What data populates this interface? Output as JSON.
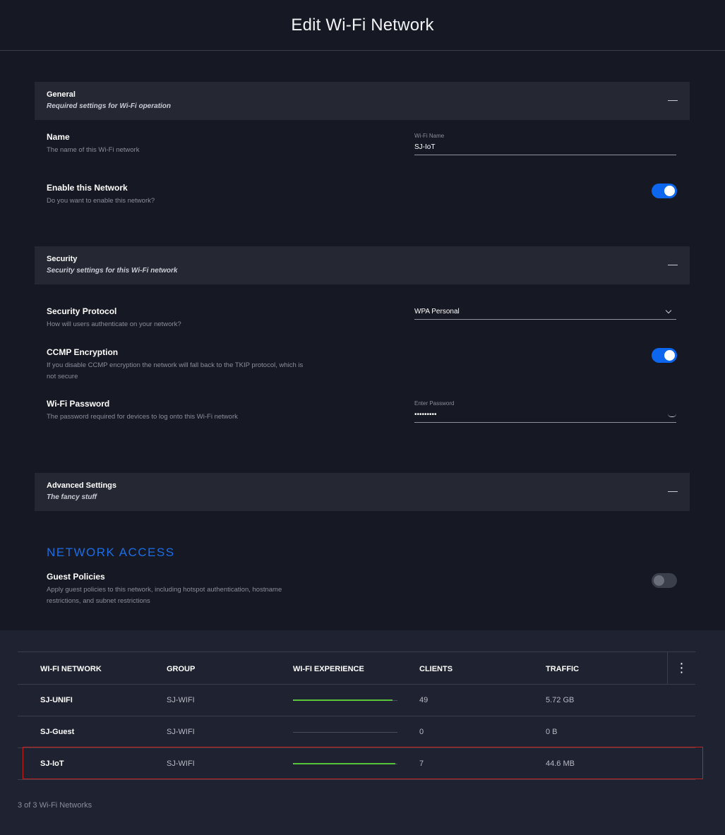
{
  "page": {
    "title": "Edit Wi-Fi Network"
  },
  "sections": {
    "general": {
      "title": "General",
      "subtitle": "Required settings for Wi-Fi operation"
    },
    "security": {
      "title": "Security",
      "subtitle": "Security settings for this Wi-Fi network"
    },
    "advanced": {
      "title": "Advanced Settings",
      "subtitle": "The fancy stuff"
    }
  },
  "general": {
    "name": {
      "label": "Name",
      "description": "The name of this Wi-Fi network",
      "field_label": "Wi-Fi Name",
      "value": "SJ-IoT"
    },
    "enable": {
      "label": "Enable this Network",
      "description": "Do you want to enable this network?",
      "enabled": true
    }
  },
  "security": {
    "protocol": {
      "label": "Security Protocol",
      "description": "How will users authenticate on your network?",
      "value": "WPA Personal"
    },
    "ccmp": {
      "label": "CCMP Encryption",
      "description": "If you disable CCMP encryption the network will fall back to the TKIP protocol, which is not secure",
      "enabled": true
    },
    "password": {
      "label": "Wi-Fi Password",
      "description": "The password required for devices to log onto this Wi-Fi network",
      "field_label": "Enter Password",
      "value": "•••••••••"
    }
  },
  "network_access": {
    "heading": "NETWORK ACCESS",
    "guest_policies": {
      "label": "Guest Policies",
      "description": "Apply guest policies to this network, including hotspot authentication, hostname restrictions, and subnet restrictions",
      "enabled": false
    }
  },
  "table": {
    "headers": [
      "WI-FI NETWORK",
      "GROUP",
      "WI-FI EXPERIENCE",
      "CLIENTS",
      "TRAFFIC"
    ],
    "menu_icon": "more-vertical-icon",
    "rows": [
      {
        "name": "SJ-UNIFI",
        "group": "SJ-WIFI",
        "experience": 0.95,
        "clients": "49",
        "traffic": "5.72 GB"
      },
      {
        "name": "SJ-Guest",
        "group": "SJ-WIFI",
        "experience": 0,
        "clients": "0",
        "traffic": "0 B"
      },
      {
        "name": "SJ-IoT",
        "group": "SJ-WIFI",
        "experience": 0.98,
        "clients": "7",
        "traffic": "44.6 MB"
      }
    ],
    "footer": "3 of 3 Wi-Fi Networks"
  },
  "colors": {
    "accent": "#0c66ee",
    "experience_good": "#58c43a",
    "highlight": "#c42121"
  }
}
